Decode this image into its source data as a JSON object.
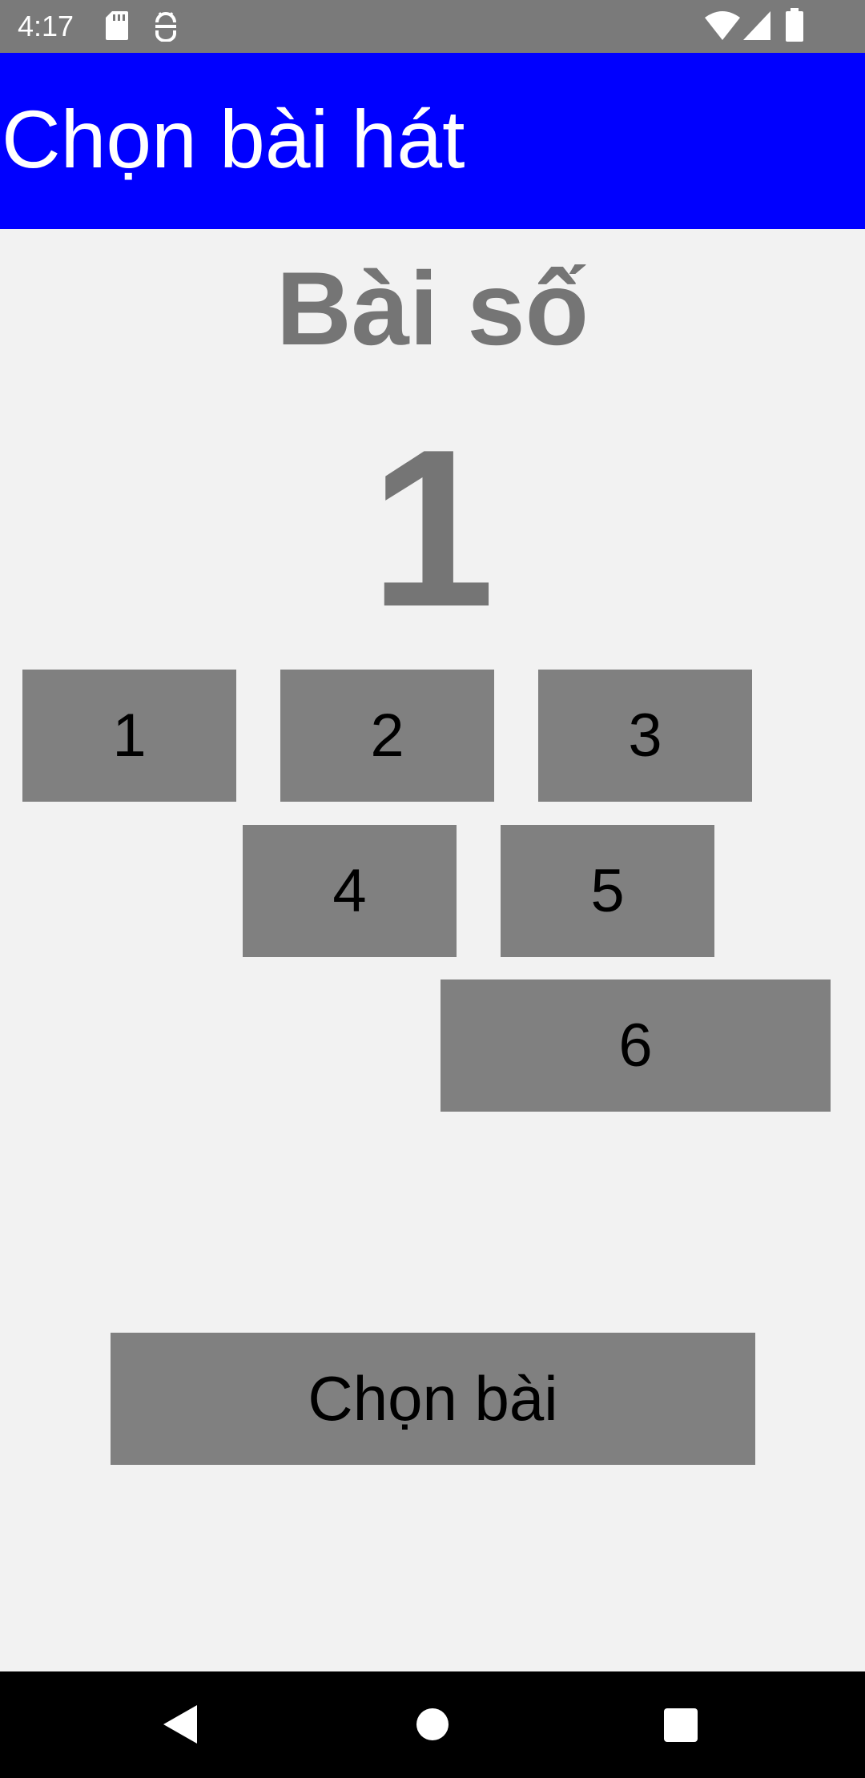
{
  "status_bar": {
    "time": "4:17",
    "icons": [
      "sd-card-icon",
      "android-debug-icon",
      "wifi-icon",
      "signal-icon",
      "battery-icon"
    ]
  },
  "app_bar": {
    "title": "Chọn bài hát",
    "color": "#0000ff"
  },
  "main": {
    "label": "Bài số",
    "selected_number": "1",
    "song_buttons": [
      "1",
      "2",
      "3",
      "4",
      "5",
      "6"
    ],
    "choose_button_label": "Chọn bài",
    "button_color": "#808080",
    "text_color": "#757575"
  },
  "nav_bar": {
    "icons": [
      "back-icon",
      "home-icon",
      "recents-icon"
    ]
  }
}
